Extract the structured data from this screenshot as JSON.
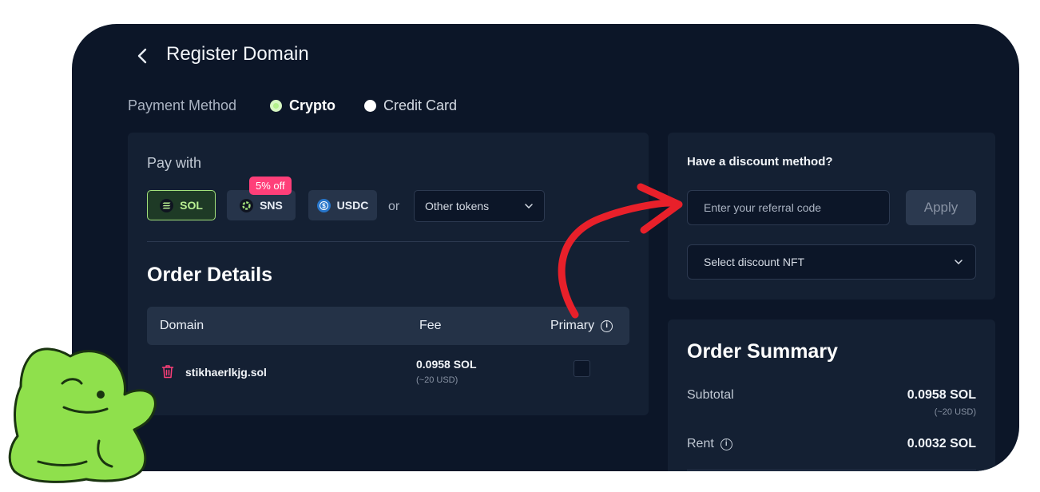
{
  "header": {
    "title": "Register Domain",
    "back_icon": "chevron-left-icon"
  },
  "payment_method": {
    "label": "Payment Method",
    "options": [
      {
        "label": "Crypto",
        "selected": true
      },
      {
        "label": "Credit Card",
        "selected": false
      }
    ]
  },
  "pay_with": {
    "label": "Pay with",
    "tokens": [
      {
        "label": "SOL",
        "icon": "sol-icon",
        "selected": true
      },
      {
        "label": "SNS",
        "icon": "sns-icon",
        "selected": false,
        "badge": "5% off"
      },
      {
        "label": "USDC",
        "icon": "usdc-icon",
        "selected": false
      }
    ],
    "or_text": "or",
    "other_select": "Other tokens"
  },
  "order_details": {
    "title": "Order Details",
    "columns": [
      "Domain",
      "Fee",
      "Primary"
    ],
    "rows": [
      {
        "domain": "stikhaerlkjg.sol",
        "fee": "0.0958 SOL",
        "fee_usd": "(~20 USD)",
        "primary": false
      }
    ]
  },
  "discount": {
    "title": "Have a discount method?",
    "referral_placeholder": "Enter your referral code",
    "apply_label": "Apply",
    "nft_select": "Select discount NFT"
  },
  "summary": {
    "title": "Order Summary",
    "subtotal_label": "Subtotal",
    "subtotal_value": "0.0958 SOL",
    "subtotal_usd": "(~20 USD)",
    "rent_label": "Rent",
    "rent_value": "0.0032 SOL"
  },
  "colors": {
    "background": "#0c1628",
    "panel": "#142033",
    "accent_green": "#a3e27c",
    "badge_pink": "#ff3f79",
    "arrow_red": "#e8202a",
    "mascot_green": "#8fe04c"
  }
}
